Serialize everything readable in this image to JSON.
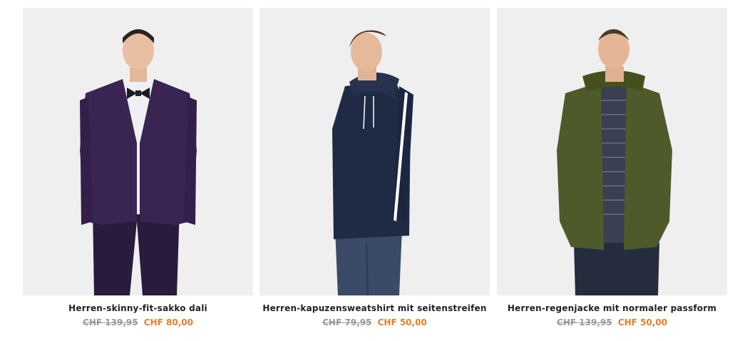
{
  "products": [
    {
      "title": "Herren-skinny-fit-sakko dali",
      "old_price": "CHF 139,95",
      "new_price": "CHF 80,00"
    },
    {
      "title": "Herren-kapuzensweatshirt mit seitenstreifen",
      "old_price": "CHF 79,95",
      "new_price": "CHF 50,00"
    },
    {
      "title": "Herren-regenjacke mit normaler passform",
      "old_price": "CHF 139,95",
      "new_price": "CHF 50,00"
    }
  ],
  "colors": {
    "sale_price": "#f07a2b",
    "old_price": "#9a9a9a",
    "photo_bg": "#efeff0"
  }
}
